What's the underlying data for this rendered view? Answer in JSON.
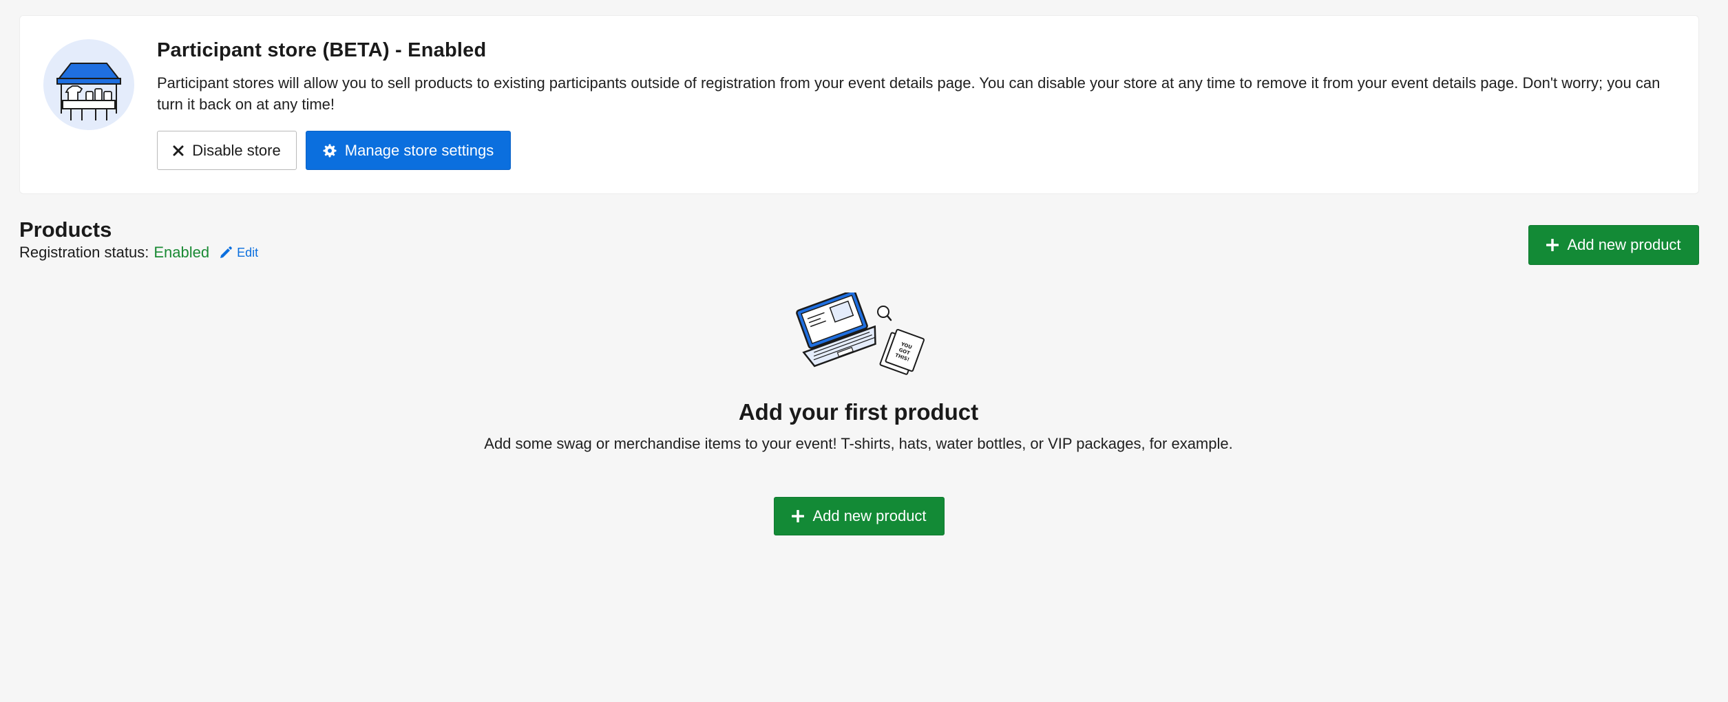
{
  "store": {
    "title": "Participant store (BETA) - Enabled",
    "description": "Participant stores will allow you to sell products to existing participants outside of registration from your event details page. You can disable your store at any time to remove it from your event details page. Don't worry; you can turn it back on at any time!",
    "disable_label": "Disable store",
    "manage_label": "Manage store settings",
    "illustration_icon": "store-tent-icon"
  },
  "products": {
    "title": "Products",
    "registration_status_label": "Registration status:",
    "registration_status_value": "Enabled",
    "edit_label": "Edit",
    "add_label": "Add new product"
  },
  "empty_state": {
    "title": "Add your first product",
    "description": "Add some swag or merchandise items to your event! T-shirts, hats, water bottles, or VIP packages, for example.",
    "add_label": "Add new product",
    "illustration_icon": "laptop-coupon-icon"
  },
  "colors": {
    "primary_blue": "#0b6fde",
    "success_green": "#138a36",
    "status_green": "#1a8a34",
    "background": "#f6f6f6"
  }
}
